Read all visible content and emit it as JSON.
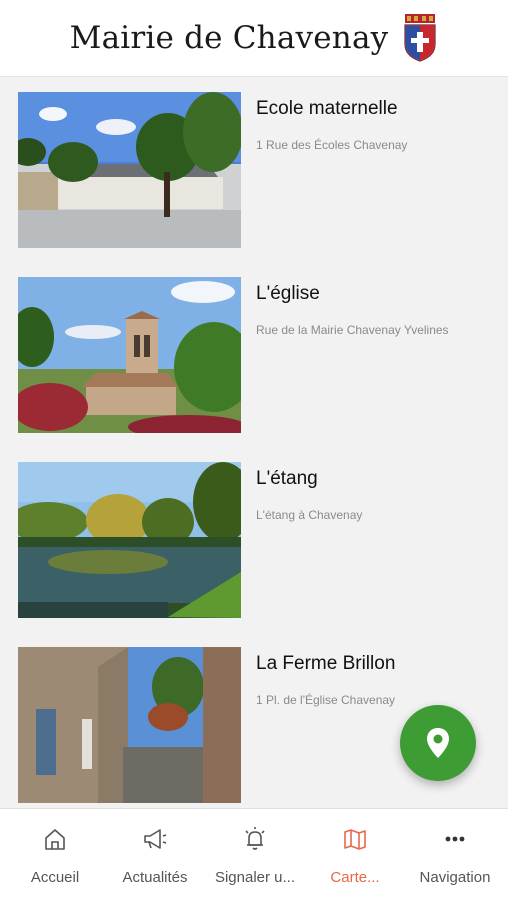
{
  "header": {
    "title": "Mairie de Chavenay",
    "crest_icon": "town-coat-of-arms-icon"
  },
  "places": [
    {
      "title": "Ecole maternelle",
      "address": "1 Rue des Écoles Chavenay"
    },
    {
      "title": "L'église",
      "address": "Rue de la Mairie Chavenay Yvelines"
    },
    {
      "title": "L'étang",
      "address": "L'étang à Chavenay"
    },
    {
      "title": "La Ferme Brillon",
      "address": "1 Pl. de l'Église Chavenay"
    }
  ],
  "fab": {
    "icon": "map-pin-icon",
    "color": "#3e9c35"
  },
  "nav": [
    {
      "label": "Accueil",
      "icon": "home-icon"
    },
    {
      "label": "Actualités",
      "icon": "megaphone-icon"
    },
    {
      "label": "Signaler u...",
      "icon": "alarm-bell-icon"
    },
    {
      "label": "Carte...",
      "icon": "map-icon",
      "active": true
    },
    {
      "label": "Navigation",
      "icon": "more-dots-icon"
    }
  ],
  "colors": {
    "accent": "#e8684a",
    "fab": "#3e9c35",
    "text": "#111111",
    "muted": "#8a8a8a"
  }
}
